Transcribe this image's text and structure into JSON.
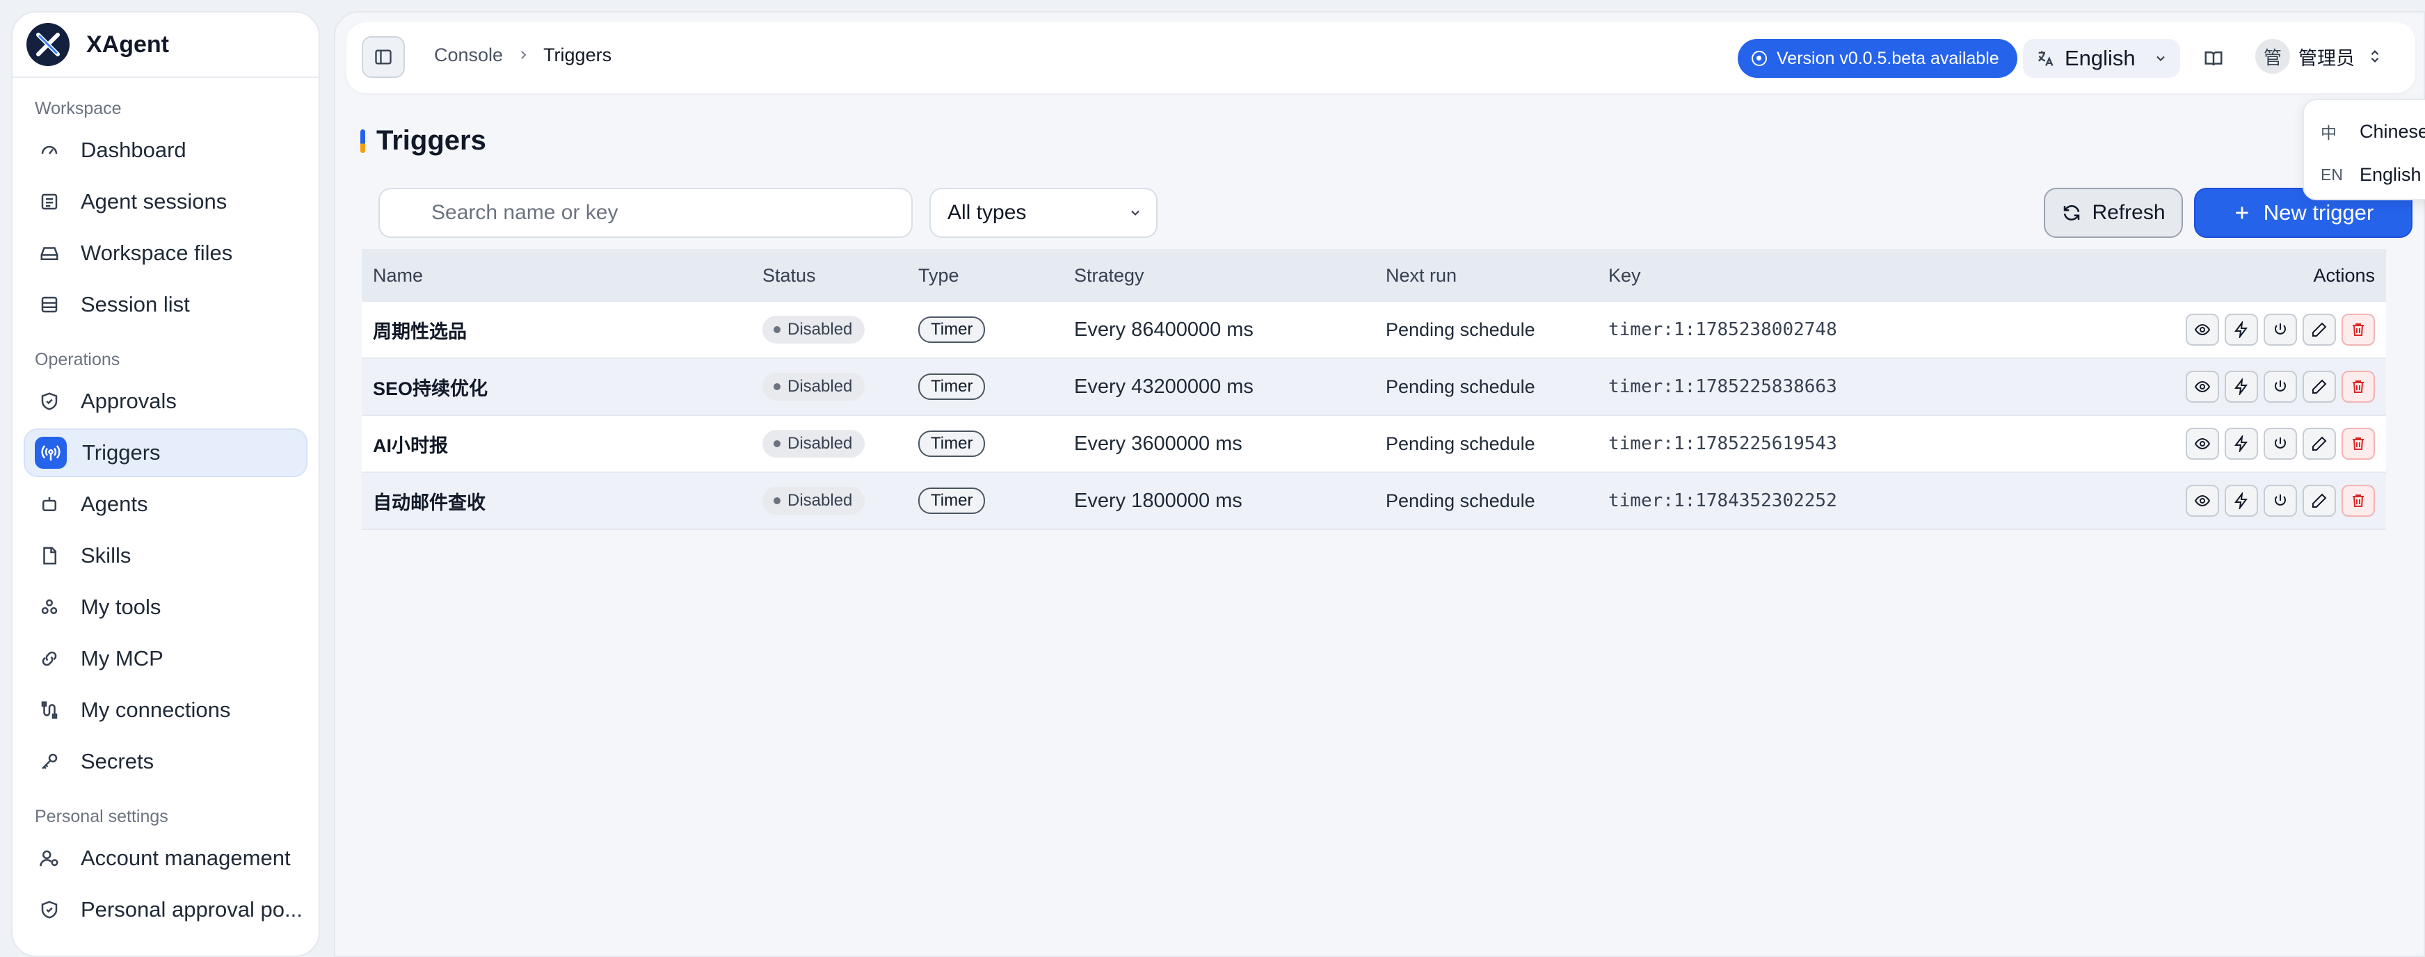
{
  "app": {
    "name": "XAgent"
  },
  "sidebar": {
    "sections": [
      {
        "title": "Workspace",
        "items": [
          {
            "label": "Dashboard",
            "icon": "gauge-icon"
          },
          {
            "label": "Agent sessions",
            "icon": "list-icon"
          },
          {
            "label": "Workspace files",
            "icon": "drive-icon"
          },
          {
            "label": "Session list",
            "icon": "table-icon"
          }
        ]
      },
      {
        "title": "Operations",
        "items": [
          {
            "label": "Approvals",
            "icon": "shield-check-icon"
          },
          {
            "label": "Triggers",
            "icon": "radio-tower-icon",
            "active": true
          },
          {
            "label": "Agents",
            "icon": "bot-icon"
          },
          {
            "label": "Skills",
            "icon": "file-icon"
          },
          {
            "label": "My tools",
            "icon": "tools-icon"
          },
          {
            "label": "My MCP",
            "icon": "link-icon"
          },
          {
            "label": "My connections",
            "icon": "connections-icon"
          },
          {
            "label": "Secrets",
            "icon": "key-icon"
          }
        ]
      },
      {
        "title": "Personal settings",
        "items": [
          {
            "label": "Account management",
            "icon": "user-cog-icon"
          },
          {
            "label": "Personal approval po...",
            "icon": "shield-icon"
          }
        ]
      }
    ]
  },
  "topbar": {
    "breadcrumb": [
      "Console",
      "Triggers"
    ],
    "version_label": "Version v0.0.5.beta available",
    "language": "English",
    "user_avatar": "管",
    "user_name": "管理员"
  },
  "language_menu": {
    "options": [
      {
        "code": "中",
        "label": "Chinese",
        "selected": false
      },
      {
        "code": "EN",
        "label": "English",
        "selected": true
      }
    ]
  },
  "page": {
    "title": "Triggers",
    "search_placeholder": "Search name or key",
    "type_filter": "All types",
    "refresh_label": "Refresh",
    "new_label": "New trigger"
  },
  "table": {
    "headers": {
      "name": "Name",
      "status": "Status",
      "type": "Type",
      "strategy": "Strategy",
      "next_run": "Next run",
      "key": "Key",
      "actions": "Actions"
    },
    "rows": [
      {
        "name": "周期性选品",
        "status": "Disabled",
        "type": "Timer",
        "strategy": "Every 86400000 ms",
        "next_run": "Pending schedule",
        "key": "timer:1:1785238002748"
      },
      {
        "name": "SEO持续优化",
        "status": "Disabled",
        "type": "Timer",
        "strategy": "Every 43200000 ms",
        "next_run": "Pending schedule",
        "key": "timer:1:1785225838663"
      },
      {
        "name": "AI小时报",
        "status": "Disabled",
        "type": "Timer",
        "strategy": "Every 3600000 ms",
        "next_run": "Pending schedule",
        "key": "timer:1:1785225619543"
      },
      {
        "name": "自动邮件查收",
        "status": "Disabled",
        "type": "Timer",
        "strategy": "Every 1800000 ms",
        "next_run": "Pending schedule",
        "key": "timer:1:1784352302252"
      }
    ]
  },
  "colors": {
    "accent": "#2563eb",
    "danger": "#dc2626",
    "muted": "#6b7280"
  }
}
